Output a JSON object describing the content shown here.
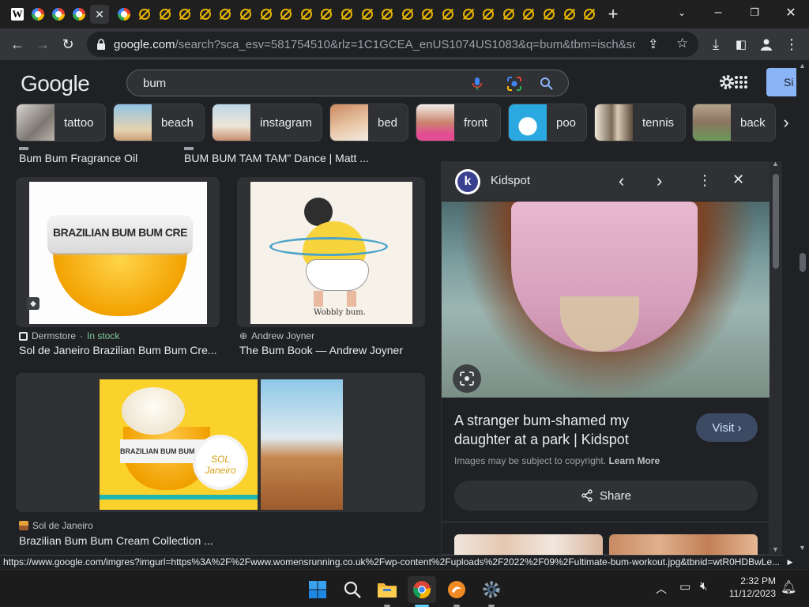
{
  "browser": {
    "url_host": "google.com",
    "url_rest": "/search?sca_esv=581754510&rlz=1C1GCEA_enUS1074US1083&q=bum&tbm=isch&source=In...",
    "new_tab_symbol": "+"
  },
  "search": {
    "logo": "Google",
    "query": "bum",
    "signin_label": "Si"
  },
  "chips": [
    {
      "label": "tattoo"
    },
    {
      "label": "beach"
    },
    {
      "label": "instagram"
    },
    {
      "label": "bed"
    },
    {
      "label": "front"
    },
    {
      "label": "poo"
    },
    {
      "label": "tennis"
    },
    {
      "label": "back"
    }
  ],
  "results": {
    "top_row": [
      {
        "title": "Bum Bum Fragrance Oil"
      },
      {
        "title": "BUM BUM TAM TAM\" Dance | Matt ..."
      }
    ],
    "row2": [
      {
        "source": "Dermstore",
        "stock": "In stock",
        "title": "Sol de Janeiro Brazilian Bum Bum Cre...",
        "product_text": "BRAZILIAN BUM BUM CREAM"
      },
      {
        "source": "Andrew Joyner",
        "title": "The Bum Book — Andrew Joyner",
        "caption": "Wobbly bum."
      }
    ],
    "row3": [
      {
        "source": "Sol de Janeiro",
        "title": "Brazilian Bum Bum Cream Collection ...",
        "product_text": "BRAZILIAN BUM BUM CREAM",
        "brand_text": "SOL Janeiro"
      }
    ]
  },
  "preview": {
    "site_initial": "k",
    "site_name": "Kidspot",
    "title_line1": "A stranger bum-shamed my",
    "title_line2": "daughter at a park | Kidspot",
    "visit_label": "Visit",
    "copyright_text": "Images may be subject to copyright.",
    "learn_more": "Learn More",
    "share_label": "Share"
  },
  "status_url": "https://www.google.com/imgres?imgurl=https%3A%2F%2Fwww.womensrunning.co.uk%2Fwp-content%2Fuploads%2F2022%2F09%2Fultimate-bum-workout.jpg&tbnid=wtR0HDBwLe...",
  "taskbar": {
    "time": "2:32 PM",
    "date": "11/12/2023"
  }
}
